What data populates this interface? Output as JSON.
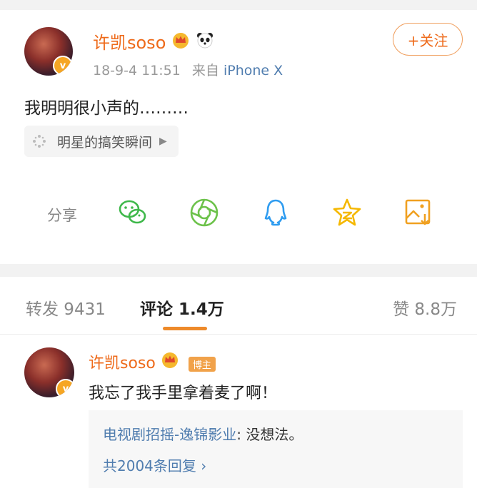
{
  "post": {
    "username": "许凯soso",
    "time": "18-9-4 11:51",
    "source_prefix": "来自",
    "source": "iPhone X",
    "follow_label": "+关注",
    "content": "我明明很小声的………",
    "topic": "明星的搞笑瞬间",
    "topic_arrow": "▶",
    "share_label": "分享",
    "share_icons": [
      "wechat-icon",
      "moments-icon",
      "qq-icon",
      "qzone-icon",
      "save-image-icon"
    ],
    "verified_badge": "v"
  },
  "tabs": {
    "repost": "转发 9431",
    "comments": "评论 1.4万",
    "likes": "赞 8.8万"
  },
  "comment": {
    "username": "许凯soso",
    "host_badge": "博主",
    "text": "我忘了我手里拿着麦了啊！",
    "reply_user": "电视剧招摇-逸锦影业",
    "reply_text": ": 没想法。",
    "reply_count": "共2004条回复 ›",
    "verified_badge": "v"
  },
  "colors": {
    "accent": "#ee6a1a",
    "link": "#507daf",
    "wechat": "#3fb84b",
    "moments": "#6cc24a",
    "qq": "#2f9cf0",
    "qzone": "#f5b800",
    "save": "#f0a020"
  }
}
